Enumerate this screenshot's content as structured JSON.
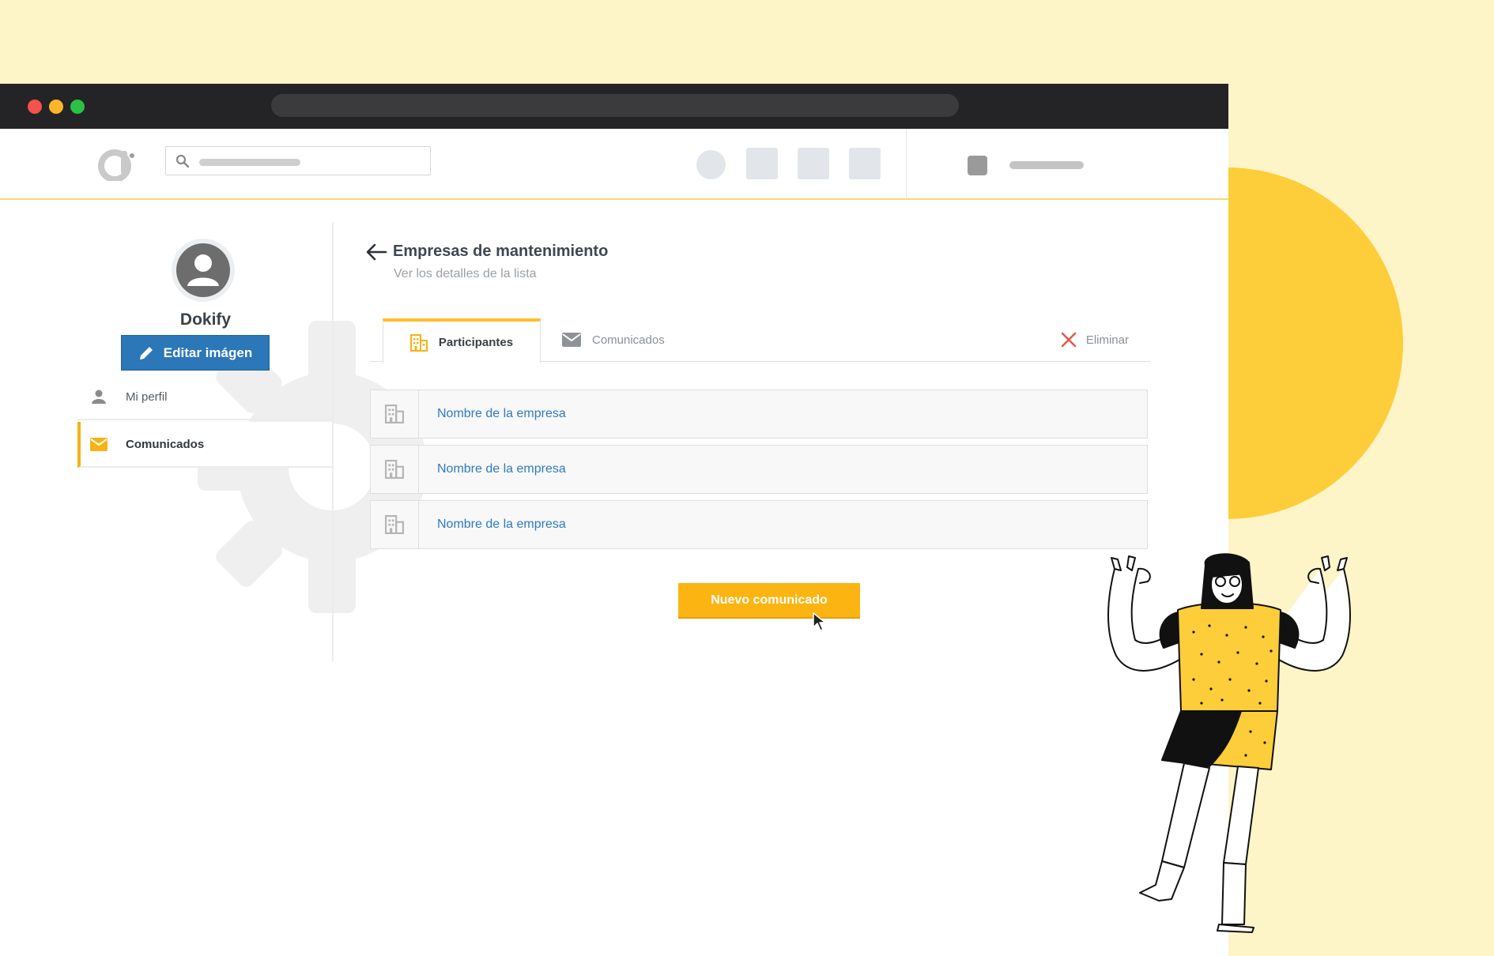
{
  "colors": {
    "background": "#fdf5c8",
    "accent": "#fdbf2d",
    "primary_button": "#2b77b8",
    "link": "#2f7bbd",
    "delete": "#e05a4c"
  },
  "sidebar": {
    "profile_name": "Dokify",
    "edit_image_label": "Editar imágen",
    "items": [
      {
        "label": "Mi perfil",
        "icon": "person-icon"
      },
      {
        "label": "Comunicados",
        "icon": "envelope-icon",
        "active": true
      }
    ]
  },
  "main": {
    "title": "Empresas de mantenimiento",
    "subtitle": "Ver los detalles de la lista",
    "tabs": [
      {
        "label": "Participantes",
        "icon": "building-icon",
        "active": true
      },
      {
        "label": "Comunicados",
        "icon": "envelope-icon"
      }
    ],
    "delete_label": "Eliminar",
    "companies": [
      {
        "name": "Nombre de la empresa"
      },
      {
        "name": "Nombre de la empresa"
      },
      {
        "name": "Nombre de la empresa"
      }
    ],
    "new_button_label": "Nuevo comunicado"
  }
}
